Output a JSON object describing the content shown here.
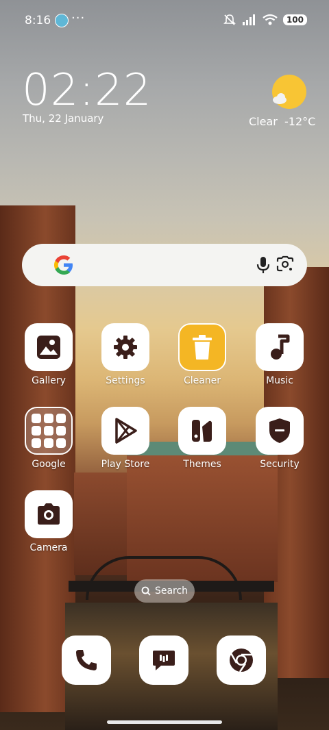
{
  "status_bar": {
    "time": "8:16",
    "more": "···",
    "battery": "100"
  },
  "clock_widget": {
    "time": "02:22",
    "date": "Thu, 22 January"
  },
  "weather": {
    "condition": "Clear",
    "temperature": "-12°C"
  },
  "search_widget": {
    "google_icon": "google-g-icon",
    "mic_icon": "mic-icon",
    "lens_icon": "lens-icon"
  },
  "apps": {
    "gallery": "Gallery",
    "settings": "Settings",
    "cleaner": "Cleaner",
    "music": "Music",
    "google": "Google",
    "play_store": "Play Store",
    "themes": "Themes",
    "security": "Security",
    "camera": "Camera"
  },
  "home_search": {
    "label": "Search"
  },
  "dock": [
    "phone-icon",
    "messages-icon",
    "chrome-icon"
  ],
  "colors": {
    "icon_fill": "#3a1e1a",
    "cleaner_bg": "#f4b624",
    "sun": "#f8c534"
  }
}
